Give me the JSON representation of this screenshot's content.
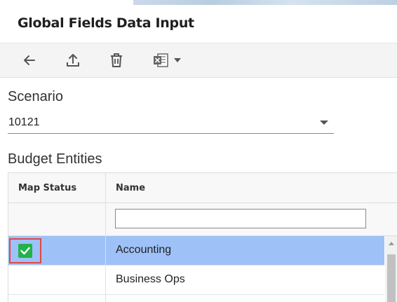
{
  "header": {
    "title": "Global Fields Data Input"
  },
  "toolbar": {
    "buttons": [
      {
        "name": "back-button",
        "icon": "arrow-left-icon"
      },
      {
        "name": "upload-button",
        "icon": "upload-icon"
      },
      {
        "name": "delete-button",
        "icon": "trash-icon"
      },
      {
        "name": "excel-export-button",
        "icon": "excel-icon"
      }
    ]
  },
  "scenario": {
    "label": "Scenario",
    "value": "10121"
  },
  "budget_entities": {
    "label": "Budget Entities",
    "columns": [
      "Map Status",
      "Name"
    ],
    "filter_placeholder": "",
    "rows": [
      {
        "map_status": "checked",
        "name": "Accounting",
        "selected": true
      },
      {
        "map_status": "",
        "name": "Business Ops",
        "selected": false
      }
    ]
  },
  "colors": {
    "selected_row": "#9ec1f7",
    "check_green": "#22b24c",
    "highlight_red": "#e04646"
  }
}
